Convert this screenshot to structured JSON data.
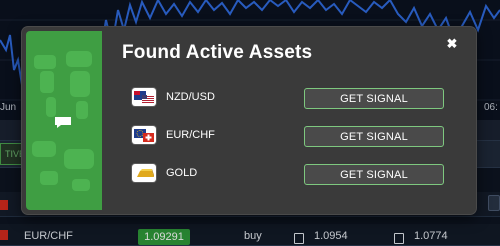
{
  "background": {
    "time_left": "Jun",
    "time_right": "06:",
    "tab_active": "TIVE",
    "row": {
      "symbol": "EUR/CHF",
      "price": "1.09291",
      "direction": "buy",
      "value_1": "1.0954",
      "value_2": "1.0774"
    }
  },
  "modal": {
    "title": "Found Active Assets",
    "close_symbol": "✖",
    "accent_color": "#3f9e43",
    "assets": [
      {
        "name": "NZD/USD",
        "icon": "nzd-usd-flags-icon",
        "button": "GET SIGNAL"
      },
      {
        "name": "EUR/CHF",
        "icon": "eur-chf-flags-icon",
        "button": "GET SIGNAL"
      },
      {
        "name": "GOLD",
        "icon": "gold-bar-icon",
        "button": "GET SIGNAL"
      }
    ]
  }
}
